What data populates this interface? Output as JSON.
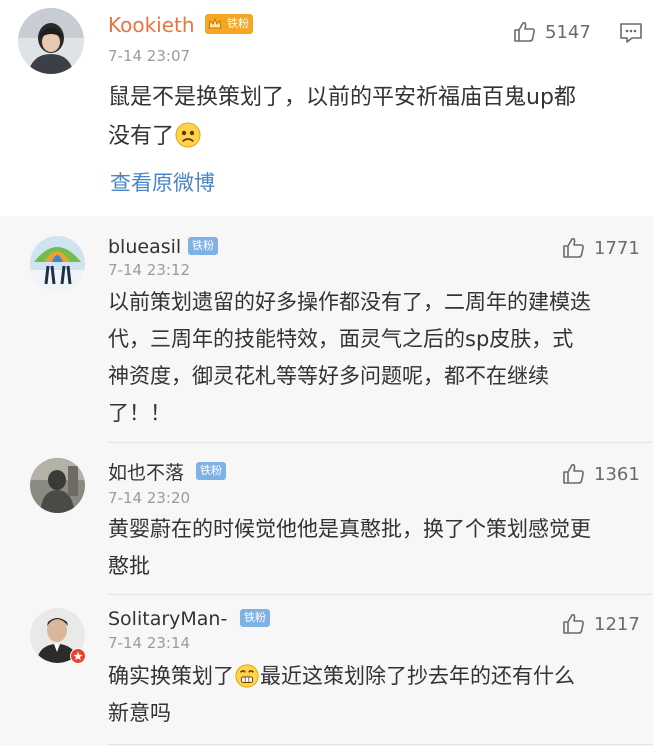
{
  "main_comment": {
    "username": "Kookieth",
    "badge": "铁粉",
    "time": "7-14 23:07",
    "text": "鼠是不是换策划了，以前的平安祈福庙百鬼up都\n没有了",
    "emoji": "sad-face",
    "likes": "5147",
    "view_original": "查看原微博"
  },
  "replies": [
    {
      "username": "blueasil",
      "badge": "铁粉",
      "time": "7-14 23:12",
      "likes": "1771",
      "text": "以前策划遗留的好多操作都没有了，二周年的建模迭\n代，三周年的技能特效，面灵气之后的sp皮肤，式\n神资度，御灵花札等等好多问题呢，都不在继续\n了！！"
    },
    {
      "username": "如也不落",
      "badge": "铁粉",
      "time": "7-14 23:20",
      "likes": "1361",
      "text": "黄婴蔚在的时候觉他他是真憨批，换了个策划感觉更\n憨批"
    },
    {
      "username": "SolitaryMan-",
      "badge": "铁粉",
      "time": "7-14 23:14",
      "likes": "1217",
      "text_before_emoji": "确实换策划了",
      "emoji": "grimace-face",
      "text_after_emoji": "最近这策划除了抄去年的还有什么\n新意吗"
    }
  ],
  "colors": {
    "username_orange": "#eb7340",
    "badge_gold": "#f5a623",
    "badge_blue": "#7fb1e5",
    "link_blue": "#4a86c5",
    "reply_background": "#f7f7f7"
  }
}
